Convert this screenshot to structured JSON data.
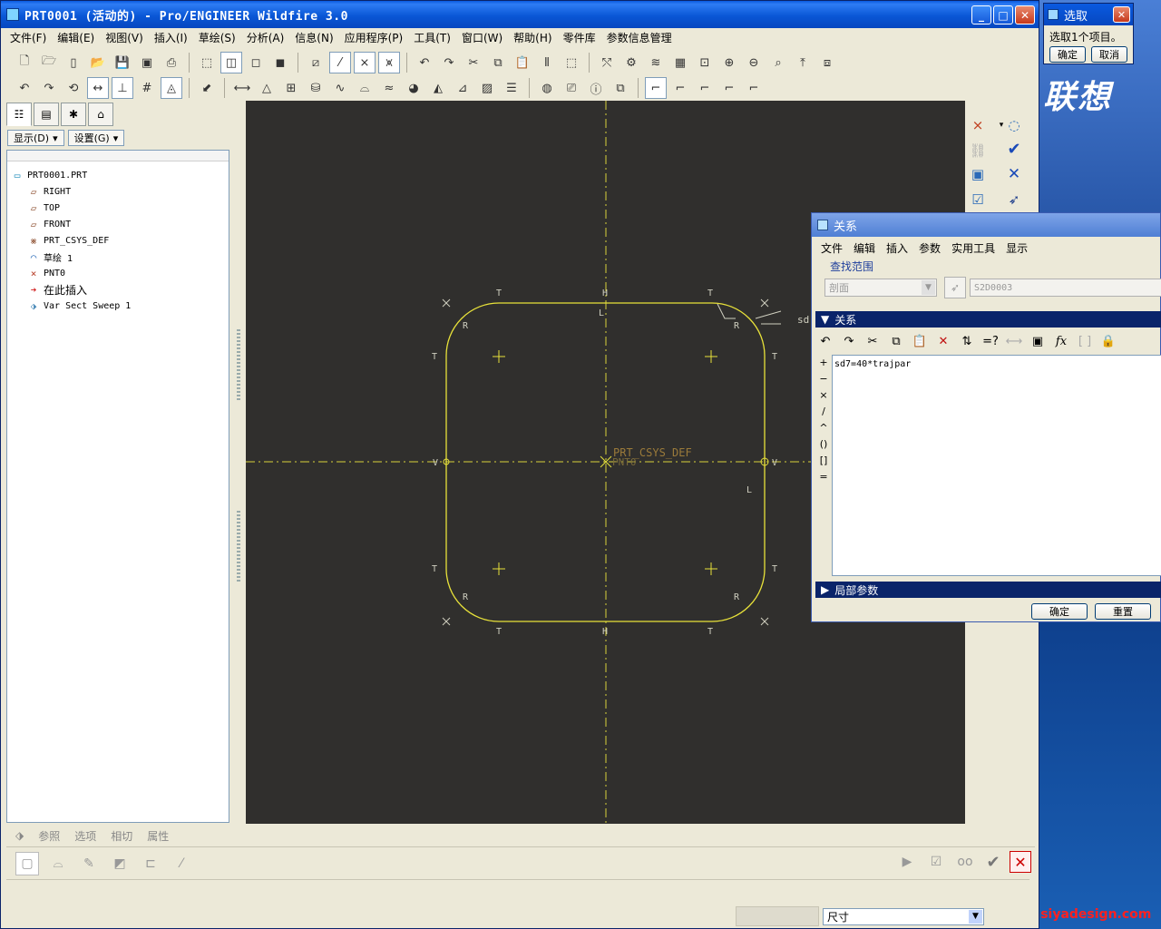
{
  "desktop": {
    "logo_text": "联想",
    "watermark": "www.nsiyadesign.com"
  },
  "window": {
    "title": "PRT0001 (活动的) - Pro/ENGINEER Wildfire 3.0",
    "minimize": "_",
    "maximize": "□",
    "close": "✕"
  },
  "menubar": [
    "文件(F)",
    "编辑(E)",
    "视图(V)",
    "插入(I)",
    "草绘(S)",
    "分析(A)",
    "信息(N)",
    "应用程序(P)",
    "工具(T)",
    "窗口(W)",
    "帮助(H)",
    "零件库",
    "参数信息管理"
  ],
  "model_tree": {
    "show_label": "显示(D)",
    "settings_label": "设置(G)",
    "items": [
      {
        "label": "PRT0001.PRT",
        "icon": "part-icon"
      },
      {
        "label": "RIGHT",
        "icon": "datum-plane-icon"
      },
      {
        "label": "TOP",
        "icon": "datum-plane-icon"
      },
      {
        "label": "FRONT",
        "icon": "datum-plane-icon"
      },
      {
        "label": "PRT_CSYS_DEF",
        "icon": "csys-icon"
      },
      {
        "label": "草绘 1",
        "icon": "sketch-icon"
      },
      {
        "label": "PNT0",
        "icon": "datum-point-icon"
      },
      {
        "label": "在此插入",
        "icon": "insert-here-arrow-icon"
      },
      {
        "label": "Var Sect Sweep 1",
        "icon": "sweep-icon"
      }
    ]
  },
  "sketch": {
    "csys_label": "PRT_CSYS_DEF",
    "point_label": "PNT0",
    "constraint_labels": {
      "T": "T",
      "R": "R",
      "H": "H",
      "V": "V",
      "L": "L"
    },
    "dim_partial": "sd",
    "colors": {
      "background": "#302f2d",
      "geometry": "#e8e23a",
      "centerline": "#d8d23c",
      "csys": "#9a7a3a",
      "constraint": "#d0d0c0"
    }
  },
  "dashboard": {
    "tabs": [
      "参照",
      "选项",
      "相切",
      "属性"
    ]
  },
  "statusbar": {
    "filter_value": "尺寸"
  },
  "select_dialog": {
    "title": "选取",
    "message": "选取1个项目。",
    "ok_label": "确定",
    "cancel_label": "取消"
  },
  "relations_dialog": {
    "title": "关系",
    "menu": [
      "文件",
      "编辑",
      "插入",
      "参数",
      "实用工具",
      "显示"
    ],
    "scope_group": "查找范围",
    "scope_type": "剖面",
    "scope_id": "S2D0003",
    "relations_section": "关系",
    "operators": [
      "+",
      "−",
      "×",
      "/",
      "^",
      "()",
      "[]",
      "="
    ],
    "relation_text": "sd7=40*trajpar",
    "local_params_section": "局部参数",
    "ok_label": "确定",
    "reset_label": "重置"
  }
}
